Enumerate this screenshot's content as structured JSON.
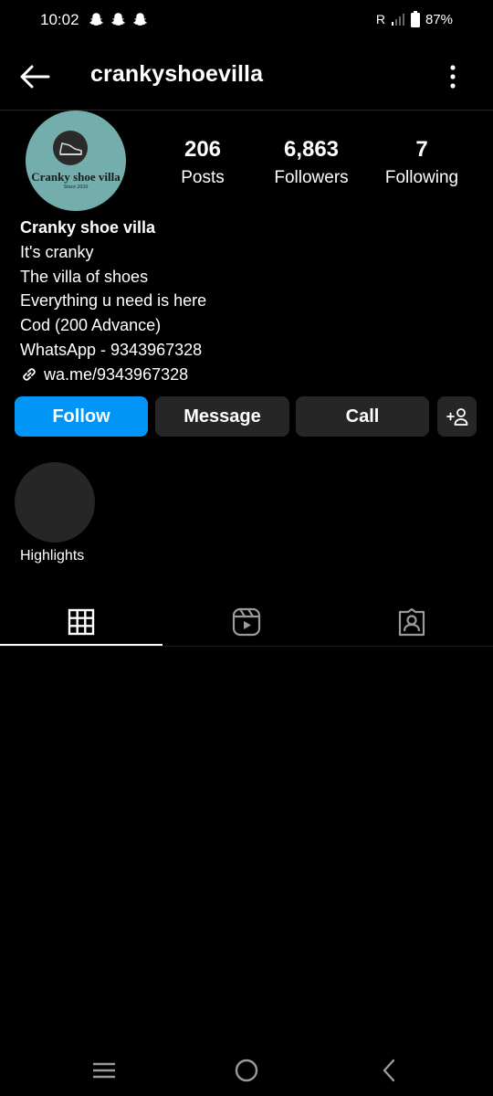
{
  "status_bar": {
    "time": "10:02",
    "carrier": "R",
    "battery": "87%"
  },
  "header": {
    "username": "crankyshoevilla"
  },
  "profile": {
    "avatar_text": "Cranky shoe villa",
    "avatar_subtext": "Since 2020",
    "stats": [
      {
        "value": "206",
        "label": "Posts"
      },
      {
        "value": "6,863",
        "label": "Followers"
      },
      {
        "value": "7",
        "label": "Following"
      }
    ],
    "name": "Cranky shoe villa",
    "bio": [
      "It's cranky",
      "The villa of shoes",
      "Everything u need is here",
      "Cod (200 Advance)",
      "WhatsApp - 9343967328"
    ],
    "link": "wa.me/9343967328"
  },
  "actions": {
    "follow": "Follow",
    "message": "Message",
    "call": "Call",
    "add_user": "+person"
  },
  "highlights": {
    "label": "Highlights"
  },
  "tabs": [
    "grid",
    "reels",
    "tagged"
  ],
  "colors": {
    "follow": "#0095f6",
    "button": "#262626",
    "avatar": "#74aeac",
    "background": "#000000"
  }
}
